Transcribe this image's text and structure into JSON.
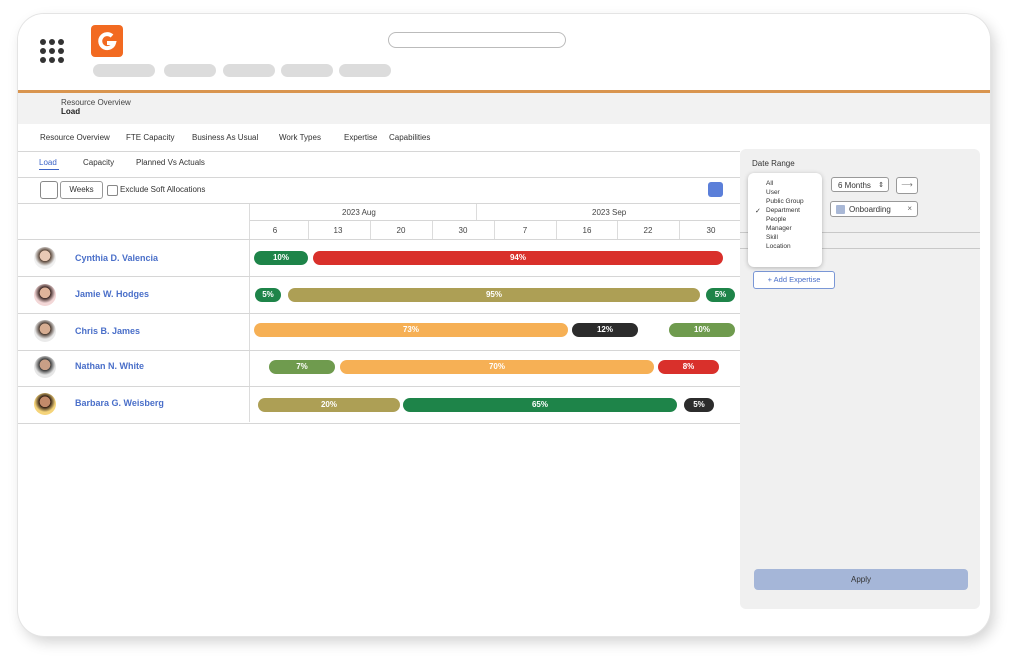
{
  "breadcrumb": {
    "parent": "Resource Overview",
    "current": "Load"
  },
  "main_tabs": [
    "Resource Overview",
    "FTE Capacity",
    "Business As Usual",
    "Work Types",
    "Expertise",
    "Capabilities"
  ],
  "sub_tabs": [
    "Load",
    "Capacity",
    "Planned Vs Actuals"
  ],
  "toolbar": {
    "period": "Weeks",
    "exclude_label": "Exclude Soft Allocations"
  },
  "timeline": {
    "months": [
      "2023 Aug",
      "2023 Sep"
    ],
    "days": [
      "6",
      "13",
      "20",
      "30",
      "7",
      "16",
      "22",
      "30"
    ]
  },
  "people": [
    {
      "name": "Cynthia D. Valencia",
      "bars": [
        {
          "label": "10%",
          "color": "#1e8449"
        },
        {
          "label": "94%",
          "color": "#d9302b"
        }
      ]
    },
    {
      "name": "Jamie W. Hodges",
      "bars": [
        {
          "label": "5%",
          "color": "#1e8449"
        },
        {
          "label": "95%",
          "color": "#ad9f55"
        },
        {
          "label": "5%",
          "color": "#1e8449"
        }
      ]
    },
    {
      "name": "Chris B. James",
      "bars": [
        {
          "label": "73%",
          "color": "#f6b055"
        },
        {
          "label": "12%",
          "color": "#2c2c2c"
        },
        {
          "label": "10%",
          "color": "#6f9b4e"
        }
      ]
    },
    {
      "name": "Nathan N. White",
      "bars": [
        {
          "label": "7%",
          "color": "#6f9b4e"
        },
        {
          "label": "70%",
          "color": "#f6b055"
        },
        {
          "label": "8%",
          "color": "#d9302b"
        }
      ]
    },
    {
      "name": "Barbara G. Weisberg",
      "bars": [
        {
          "label": "20%",
          "color": "#ad9f55"
        },
        {
          "label": "65%",
          "color": "#1e8449"
        },
        {
          "label": "5%",
          "color": "#2c2c2c"
        }
      ]
    }
  ],
  "panel": {
    "date_range_label": "Date Range",
    "dropdown_options": [
      "All",
      "User",
      "Public Group",
      "Department",
      "People",
      "Manager",
      "Skill",
      "Location"
    ],
    "dropdown_selected": "Department",
    "months_select": "6 Months",
    "arrow": "⟶",
    "tag": "Onboarding",
    "tag_remove": "×",
    "add_expertise": "+ Add Expertise",
    "apply": "Apply"
  },
  "colors": {
    "accent_orange": "#f26a21",
    "link_blue": "#4a6fc9",
    "orange_line": "#d9954f"
  }
}
